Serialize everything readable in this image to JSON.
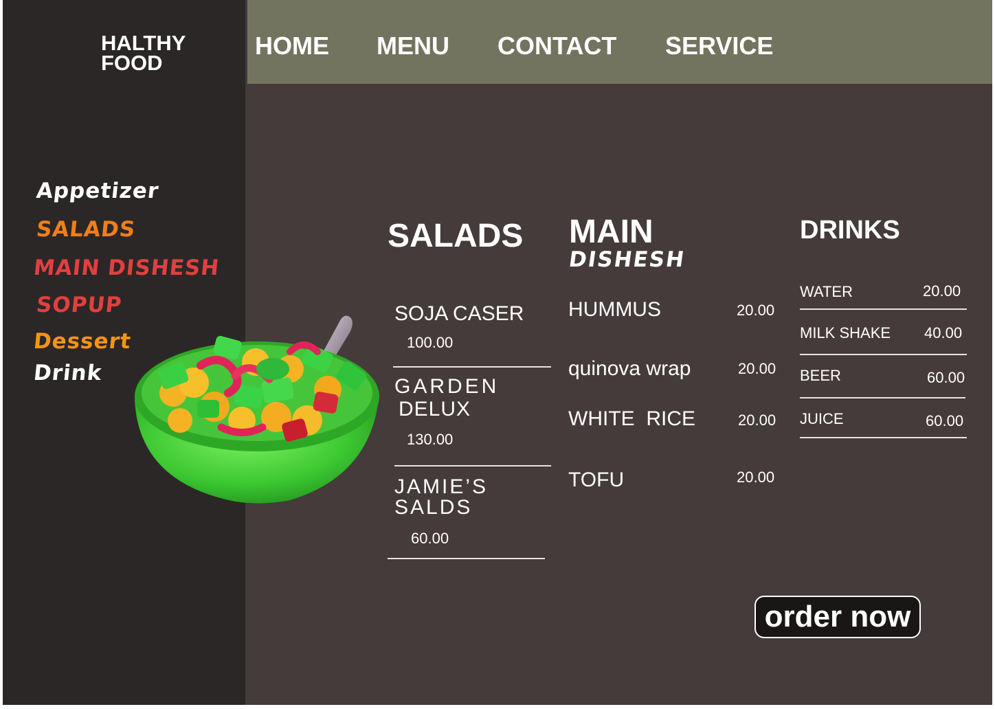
{
  "brand": {
    "line1": "HALTHY",
    "line2": "FOOD"
  },
  "nav": [
    "HOME",
    "MENU",
    "CONTACT",
    "SERVICE"
  ],
  "categories": [
    {
      "label": "Appetizer",
      "color": "#ffffff"
    },
    {
      "label": "SALADS",
      "color": "#f07f1b"
    },
    {
      "label": "MAIN DISHESH",
      "color": "#e04040"
    },
    {
      "label": "SOPUP",
      "color": "#e04040"
    },
    {
      "label": "Dessert",
      "color": "#f39419"
    },
    {
      "label": "Drink",
      "color": "#ffffff"
    }
  ],
  "salads": {
    "title": "SALADS",
    "items": [
      {
        "name": "SOJA CASER",
        "price": "100.00"
      },
      {
        "name1": "GARDEN",
        "name2": "DELUX",
        "price": "130.00"
      },
      {
        "name1": "JAMIE’S",
        "name2": "SALDS",
        "price": "60.00"
      }
    ]
  },
  "main": {
    "title1": "MAIN",
    "title2": "DISHESH",
    "items": [
      {
        "name": "HUMMUS",
        "price": "20.00"
      },
      {
        "name": "quinova wrap",
        "price": "20.00"
      },
      {
        "name": "WHITE  RICE",
        "price": "20.00"
      },
      {
        "name": "TOFU",
        "price": "20.00"
      }
    ]
  },
  "drinks": {
    "title": "DRINKS",
    "items": [
      {
        "name": "WATER",
        "price": "20.00"
      },
      {
        "name": "MILK SHAKE",
        "price": "40.00"
      },
      {
        "name": "BEER",
        "price": "60.00"
      },
      {
        "name": "JUICE",
        "price": "60.00"
      }
    ]
  },
  "order_button": "order now",
  "colors": {
    "sidebar": "#2c2727",
    "topbar": "#737460",
    "main": "#453b3a"
  }
}
